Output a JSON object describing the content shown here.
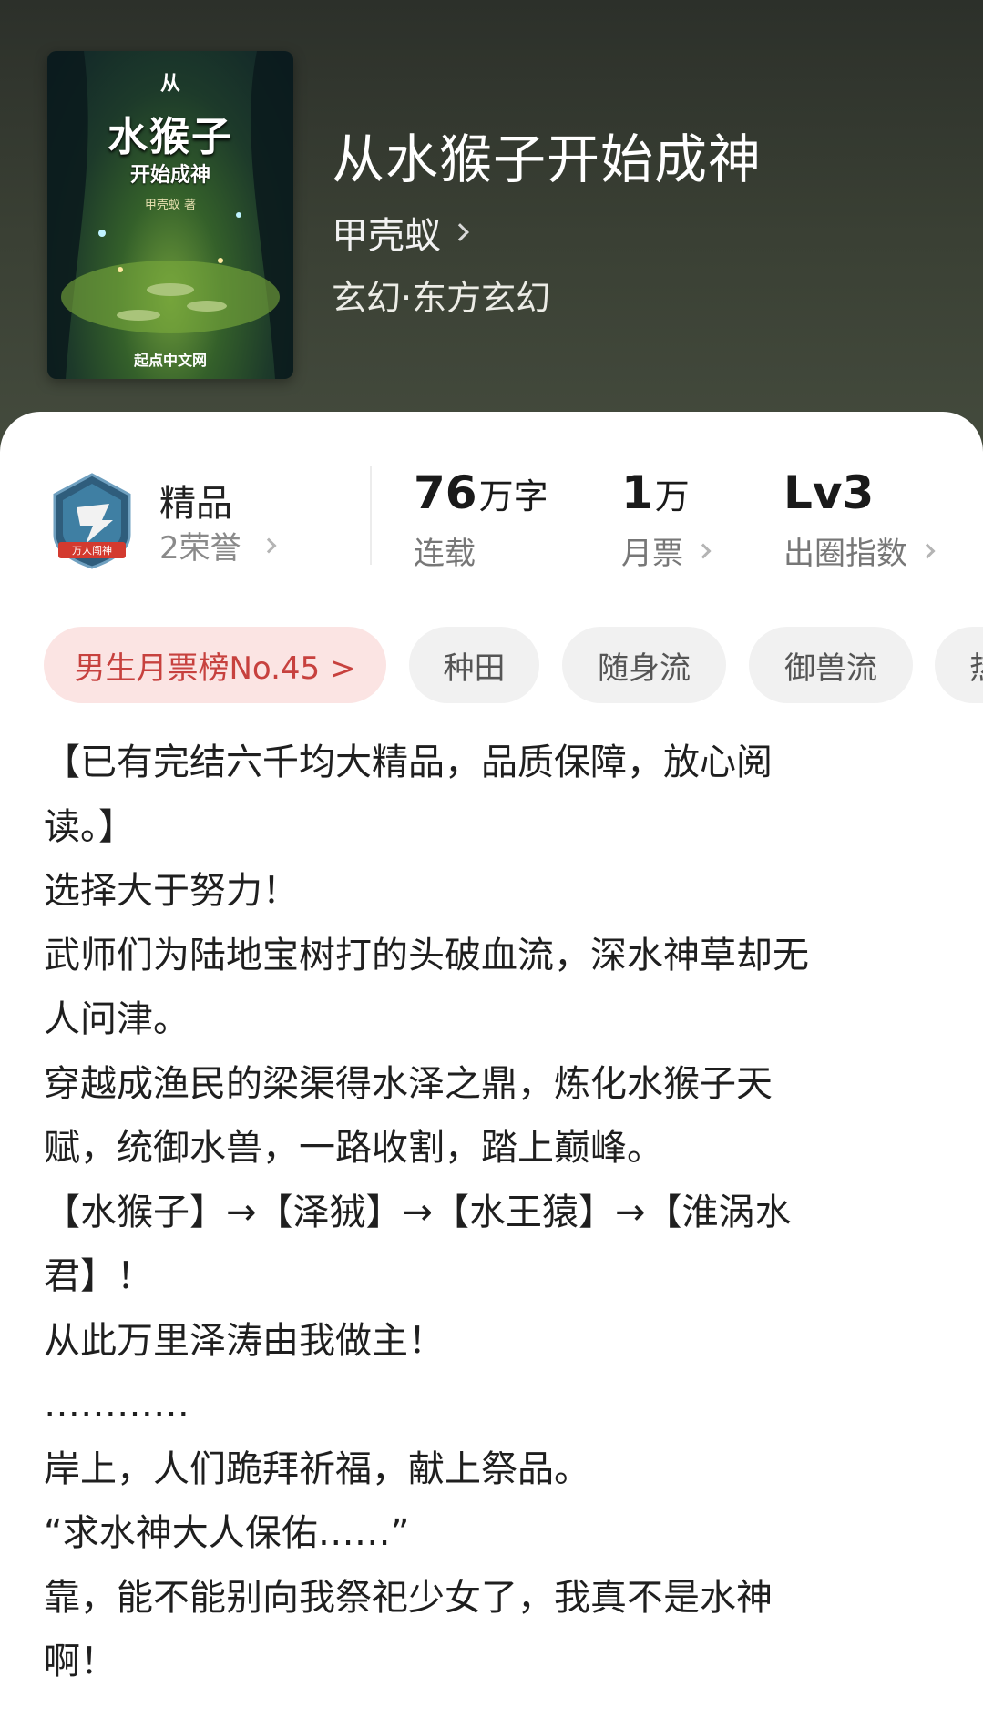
{
  "book": {
    "cover": {
      "from": "从",
      "main": "水猴子",
      "sub": "开始成神",
      "author": "甲壳蚁 著",
      "publisher": "起点中文网"
    },
    "title": "从水猴子开始成神",
    "author": "甲壳蚁",
    "genre": "玄幻·东方玄幻"
  },
  "stats": {
    "honor": {
      "badge_text": "万人闯神",
      "title": "精品",
      "count": "2荣誉"
    },
    "words": {
      "value": "76",
      "unit": "万字",
      "label": "连载"
    },
    "monthly": {
      "value": "1",
      "unit": "万",
      "label": "月票"
    },
    "level": {
      "value": "Lv3",
      "label": "出圈指数"
    }
  },
  "tags": [
    "男生月票榜No.45 >",
    "种田",
    "随身流",
    "御兽流",
    "热"
  ],
  "description": [
    "【已有完结六千均大精品，品质保障，放心阅",
    "读。】",
    "选择大于努力！",
    "武师们为陆地宝树打的头破血流，深水神草却无",
    "人问津。",
    "穿越成渔民的梁渠得水泽之鼎，炼化水猴子天",
    "赋，统御水兽，一路收割，踏上巅峰。",
    "【水猴子】→【泽狨】→【水王猿】→【淮涡水",
    "君】！",
    "从此万里泽涛由我做主！",
    "…………",
    "岸上，人们跪拜祈福，献上祭品。",
    "“求水神大人保佑……”",
    "靠，能不能别向我祭祀少女了，我真不是水神",
    "啊！"
  ],
  "colors": {
    "header_bg": "#3a4034",
    "rank_tag_bg": "#fbe4e3",
    "rank_tag_text": "#c7413e",
    "tag_bg": "#f1f1f1"
  }
}
